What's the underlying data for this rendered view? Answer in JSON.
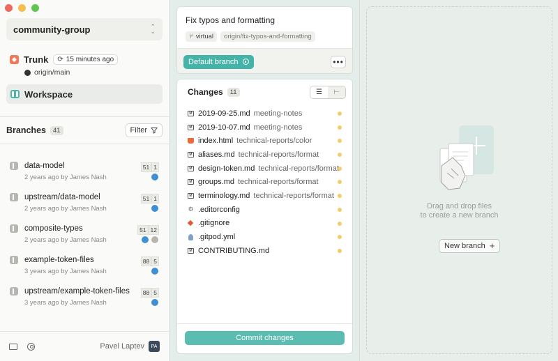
{
  "sidebar": {
    "workspace_name": "community-group",
    "trunk": {
      "label": "Trunk",
      "time": "15 minutes ago",
      "origin": "origin/main"
    },
    "workspace_label": "Workspace",
    "branches_title": "Branches",
    "branches_count": "41",
    "filter_label": "Filter",
    "branches": [
      {
        "name": "data-model",
        "meta": "2 years ago by James Nash",
        "diff_a": "51",
        "diff_b": "1"
      },
      {
        "name": "upstream/data-model",
        "meta": "2 years ago by James Nash",
        "diff_a": "51",
        "diff_b": "1"
      },
      {
        "name": "composite-types",
        "meta": "2 years ago by James Nash",
        "diff_a": "51",
        "diff_b": "12"
      },
      {
        "name": "example-token-files",
        "meta": "3 years ago by James Nash",
        "diff_a": "88",
        "diff_b": "5"
      },
      {
        "name": "upstream/example-token-files",
        "meta": "3 years ago by James Nash",
        "diff_a": "88",
        "diff_b": "5"
      }
    ],
    "user_name": "Pavel Laptev",
    "user_initials": "PA"
  },
  "branch_card": {
    "title": "Fix typos and formatting",
    "tag_virtual": "virtual",
    "tag_remote": "origin/fix-typos-and-formatting",
    "default_branch_label": "Default branch",
    "more_label": "•••"
  },
  "changes": {
    "title": "Changes",
    "count": "11",
    "files": [
      {
        "name": "2019-09-25.md",
        "dir": "meeting-notes",
        "type": "md"
      },
      {
        "name": "2019-10-07.md",
        "dir": "meeting-notes",
        "type": "md"
      },
      {
        "name": "index.html",
        "dir": "technical-reports/color",
        "type": "html"
      },
      {
        "name": "aliases.md",
        "dir": "technical-reports/format",
        "type": "md"
      },
      {
        "name": "design-token.md",
        "dir": "technical-reports/format",
        "type": "md"
      },
      {
        "name": "groups.md",
        "dir": "technical-reports/format",
        "type": "md"
      },
      {
        "name": "terminology.md",
        "dir": "technical-reports/format",
        "type": "md"
      },
      {
        "name": ".editorconfig",
        "dir": "",
        "type": "cfg"
      },
      {
        "name": ".gitignore",
        "dir": "",
        "type": "git"
      },
      {
        "name": ".gitpod.yml",
        "dir": "",
        "type": "yml"
      },
      {
        "name": "CONTRIBUTING.md",
        "dir": "",
        "type": "md"
      }
    ],
    "commit_label": "Commit changes",
    "status_color": "#f1cd6f"
  },
  "drop_zone": {
    "line1": "Drag and drop files",
    "line2": "to create a new branch",
    "new_branch_label": "New branch"
  },
  "colors": {
    "accent": "#44b3a8",
    "trunk": "#f07a5a"
  }
}
